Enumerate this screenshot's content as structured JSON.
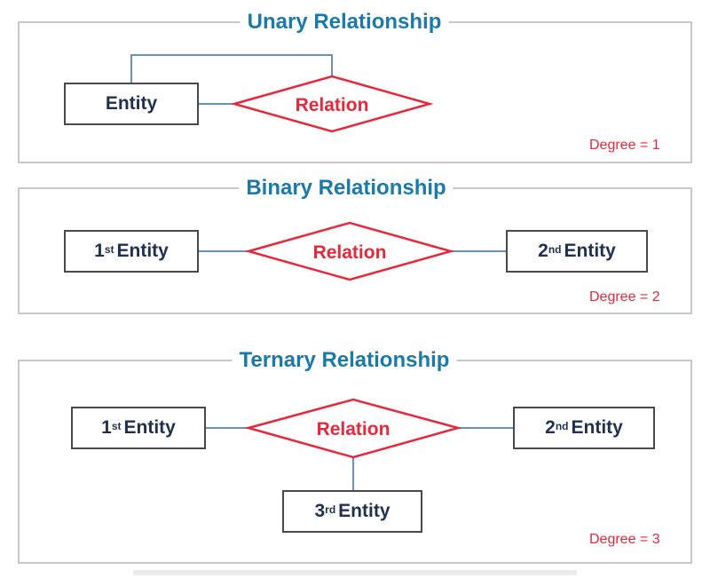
{
  "colors": {
    "title": "#1a7aab",
    "relation": "#e8283a",
    "entity_text": "#1f3050",
    "entity_border": "#4a4a4a",
    "panel_border": "#c8c8c8",
    "connector": "#6a8fc4"
  },
  "unary": {
    "title": "Unary Relationship",
    "entity": "Entity",
    "relation": "Relation",
    "degree": "Degree =  1"
  },
  "binary": {
    "title": "Binary Relationship",
    "entity1": {
      "num": "1",
      "sup": "st",
      "label": "Entity"
    },
    "entity2": {
      "num": "2",
      "sup": "nd",
      "label": "Entity"
    },
    "relation": "Relation",
    "degree": "Degree = 2"
  },
  "ternary": {
    "title": "Ternary Relationship",
    "entity1": {
      "num": "1",
      "sup": "st",
      "label": "Entity"
    },
    "entity2": {
      "num": "2",
      "sup": "nd",
      "label": "Entity"
    },
    "entity3": {
      "num": "3",
      "sup": "rd",
      "label": "Entity"
    },
    "relation": "Relation",
    "degree": "Degree = 3"
  }
}
